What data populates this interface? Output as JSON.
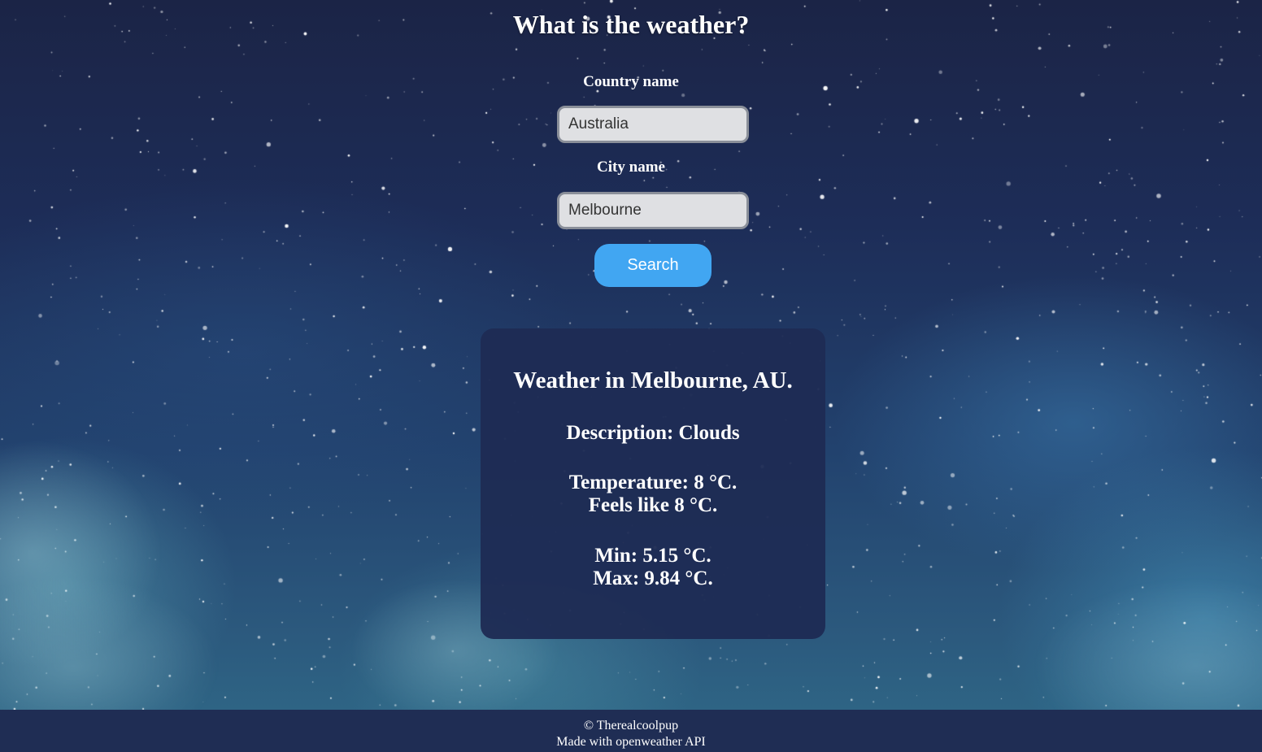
{
  "page": {
    "title": "What is the weather?"
  },
  "form": {
    "country_label": "Country name",
    "country_value": "Australia",
    "city_label": "City name",
    "city_value": "Melbourne",
    "search_label": "Search"
  },
  "weather": {
    "heading": "Weather in Melbourne, AU.",
    "description": "Description: Clouds",
    "temperature": "Temperature: 8 °C.",
    "feels_like": "Feels like 8 °C.",
    "min": "Min: 5.15 °C.",
    "max": "Max: 9.84 °C."
  },
  "footer": {
    "copyright": "© Therealcoolpup",
    "credit": "Made with openweather API"
  },
  "colors": {
    "button": "#41a6f2",
    "card": "#1e2c54",
    "footer": "#1f2d54",
    "input_bg": "#dfe0e3"
  }
}
